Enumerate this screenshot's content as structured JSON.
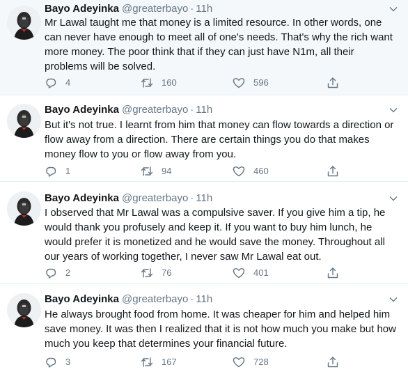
{
  "tweets": [
    {
      "name": "Bayo Adeyinka",
      "handle": "@greaterbayo",
      "time": "11h",
      "text_lines": [
        "Mr Lawal taught me that money is a limited resource. In other words, one",
        "can never have enough to meet all of one's needs. That's why the rich want",
        "more money. The poor think that if they can just have N1m, all their",
        "problems will be solved."
      ],
      "replies": "4",
      "retweets": "160",
      "likes": "596"
    },
    {
      "name": "Bayo Adeyinka",
      "handle": "@greaterbayo",
      "time": "11h",
      "text_lines": [
        "But it's not true. I learnt from him that money can flow towards a direction or",
        "flow away from a direction. There are certain things you do that makes",
        "money flow to you or flow away from you."
      ],
      "replies": "1",
      "retweets": "94",
      "likes": "460"
    },
    {
      "name": "Bayo Adeyinka",
      "handle": "@greaterbayo",
      "time": "11h",
      "text_lines": [
        "I observed that Mr Lawal was a compulsive saver. If you give him a tip, he",
        "would thank you profusely and keep it. If you want to buy him lunch, he",
        "would prefer it is monetized and he would save the money. Throughout all",
        "our years of working together, I never saw Mr Lawal eat out."
      ],
      "replies": "2",
      "retweets": "76",
      "likes": "401"
    },
    {
      "name": "Bayo Adeyinka",
      "handle": "@greaterbayo",
      "time": "11h",
      "text_lines": [
        "He always brought food from home. It was cheaper for him and helped him",
        "save money. It was then I realized that it is not how much you make but how",
        "much you keep that determines your financial future."
      ],
      "replies": "3",
      "retweets": "167",
      "likes": "728"
    }
  ],
  "icons": {
    "reply": "reply-icon",
    "retweet": "retweet-icon",
    "like": "heart-icon",
    "share": "share-icon",
    "menu": "chevron-down-icon"
  },
  "colors": {
    "highlight_bg": "#f5f8fa",
    "secondary_text": "#657786",
    "border": "#e6ecf0"
  }
}
